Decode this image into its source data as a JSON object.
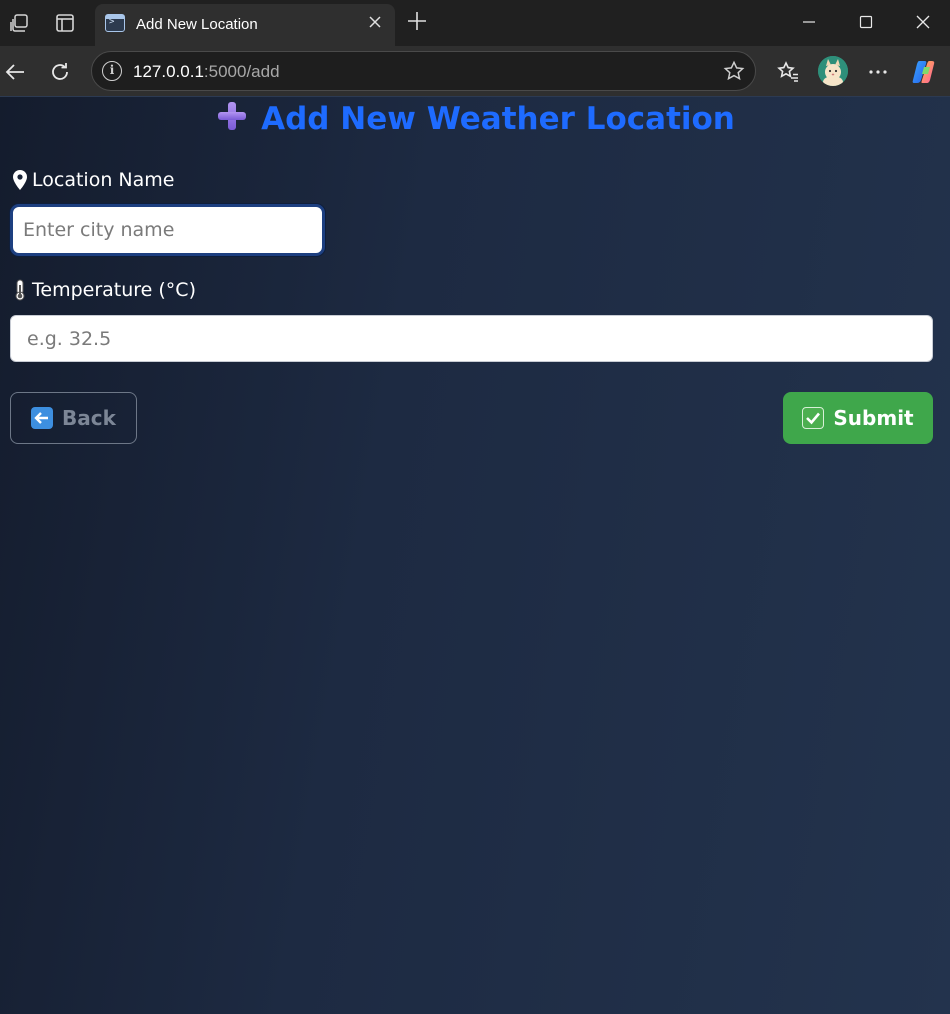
{
  "browser": {
    "tab_title": "Add New Location",
    "url_host": "127.0.0.1",
    "url_rest": ":5000/add",
    "icons": {
      "workspaces": "workspaces-icon",
      "tab_actions": "vertical-tabs-icon",
      "close_tab": "close-icon",
      "new_tab": "plus-icon",
      "minimize": "minimize-icon",
      "maximize": "maximize-icon",
      "close_window": "close-icon",
      "back": "back-arrow-icon",
      "reload": "reload-icon",
      "site_info": "info-icon",
      "favorite": "star-icon",
      "favorites": "favorites-icon",
      "profile": "avatar",
      "more": "more-icon",
      "copilot": "copilot-icon"
    }
  },
  "page": {
    "title": "Add New Weather Location",
    "location_label": "Location Name",
    "location_placeholder": "Enter city name",
    "temperature_label": "Temperature (°C)",
    "temperature_placeholder": "e.g. 32.5",
    "back_label": "Back",
    "submit_label": "Submit",
    "colors": {
      "title": "#1e6bff",
      "submit_bg": "#3fa74b",
      "background_start": "#141c2d",
      "background_end": "#23334d"
    }
  }
}
